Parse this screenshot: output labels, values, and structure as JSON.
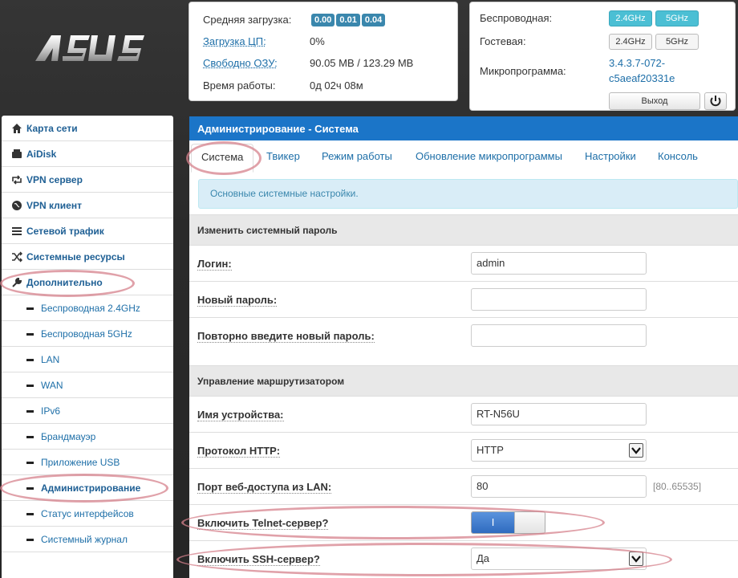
{
  "brand": {
    "logo_text": "ASUS"
  },
  "status": {
    "load_label": "Средняя загрузка:",
    "load_values": [
      "0.00",
      "0.01",
      "0.04"
    ],
    "cpu_label": "Загрузка ЦП:",
    "cpu_value": "0%",
    "ram_label": "Свободно ОЗУ:",
    "ram_value": "90.05 MB / 123.29 MB",
    "uptime_label": "Время работы:",
    "uptime_value": "0д 02ч 08м",
    "wireless_label": "Беспроводная:",
    "guest_label": "Гостевая:",
    "band_24": "2.4GHz",
    "band_5": "5GHz",
    "firmware_label": "Микропрограмма:",
    "firmware_line1": "3.4.3.7-072-",
    "firmware_line2": "c5aeaf20331e",
    "logout_label": "Выход"
  },
  "sidebar": {
    "items": [
      {
        "label": "Карта сети",
        "icon": "home-icon"
      },
      {
        "label": "AiDisk",
        "icon": "hdd-icon"
      },
      {
        "label": "VPN сервер",
        "icon": "retweet-icon"
      },
      {
        "label": "VPN клиент",
        "icon": "globe-icon"
      },
      {
        "label": "Сетевой трафик",
        "icon": "list-icon"
      },
      {
        "label": "Системные ресурсы",
        "icon": "random-icon"
      },
      {
        "label": "Дополнительно",
        "icon": "wrench-icon"
      }
    ],
    "subitems": [
      "Беспроводная 2.4GHz",
      "Беспроводная 5GHz",
      "LAN",
      "WAN",
      "IPv6",
      "Брандмауэр",
      "Приложение USB",
      "Администрирование",
      "Статус интерфейсов",
      "Системный журнал"
    ]
  },
  "main": {
    "title": "Администрирование - Система",
    "tabs": [
      "Система",
      "Твикер",
      "Режим работы",
      "Обновление микропрограммы",
      "Настройки",
      "Консоль"
    ],
    "info": "Основные системные настройки.",
    "section_password": "Изменить системный пароль",
    "login_label": "Логин:",
    "login_value": "admin",
    "new_password_label": "Новый пароль:",
    "repeat_password_label": "Повторно введите новый пароль:",
    "section_router": "Управление маршрутизатором",
    "device_name_label": "Имя устройства:",
    "device_name_value": "RT-N56U",
    "http_protocol_label": "Протокол HTTP:",
    "http_protocol_value": "HTTP",
    "port_label": "Порт веб-доступа из LAN:",
    "port_value": "80",
    "port_range": "[80..65535]",
    "telnet_label": "Включить Telnet-сервер?",
    "telnet_on_text": "I",
    "ssh_label": "Включить SSH-сервер?",
    "ssh_value": "Да"
  }
}
